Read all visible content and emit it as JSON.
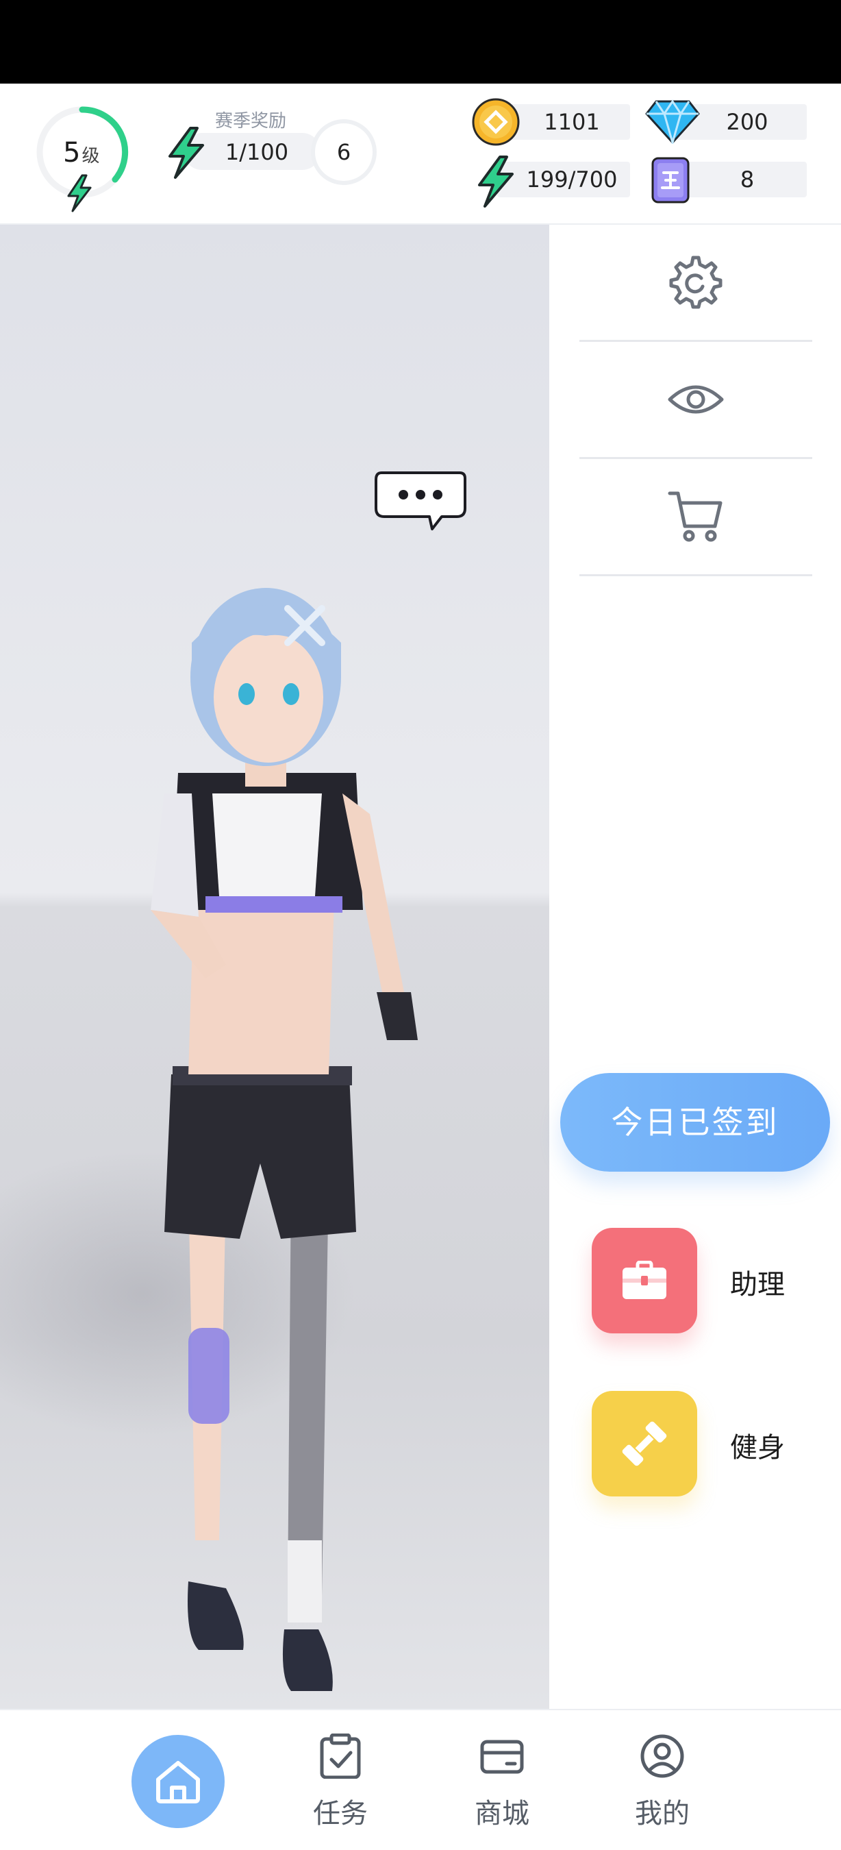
{
  "header": {
    "level": {
      "value": "5",
      "unit": "级",
      "progress": 0.42,
      "ring_color": "#2fd08a"
    },
    "season": {
      "label": "赛季奖励",
      "progress": "1/100",
      "count": "6"
    },
    "resources": {
      "coins": {
        "icon": "coin-icon",
        "value": "1101"
      },
      "diamonds": {
        "icon": "diamond-icon",
        "value": "200"
      },
      "energy": {
        "icon": "energy-bolt-icon",
        "value": "199/700"
      },
      "tickets": {
        "icon": "ticket-card-icon",
        "value": "8"
      }
    }
  },
  "side_panel": {
    "buttons": [
      {
        "icon": "gear-icon"
      },
      {
        "icon": "eye-icon"
      },
      {
        "icon": "cart-icon"
      }
    ],
    "signin_label": "今日已签到",
    "actions": [
      {
        "label": "助理",
        "icon": "briefcase-icon",
        "color": "#f4707a"
      },
      {
        "label": "健身",
        "icon": "dumbbell-icon",
        "color": "#f6d04a"
      }
    ]
  },
  "bottom_nav": {
    "items": [
      {
        "label": "",
        "icon": "home-icon",
        "active": true
      },
      {
        "label": "任务",
        "icon": "task-icon"
      },
      {
        "label": "商城",
        "icon": "shop-card-icon"
      },
      {
        "label": "我的",
        "icon": "profile-icon"
      }
    ],
    "accent": "#7db7f8"
  }
}
